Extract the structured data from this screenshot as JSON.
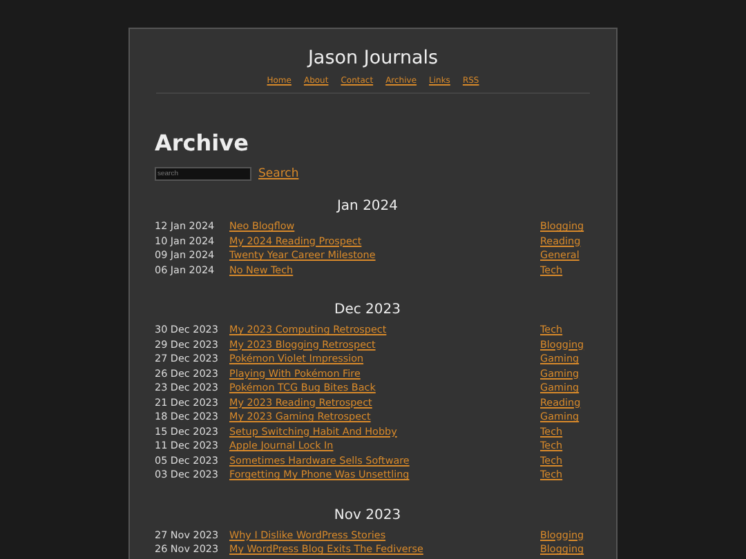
{
  "site_title": "Jason Journals",
  "nav": [
    "Home",
    "About",
    "Contact",
    "Archive",
    "Links",
    "RSS"
  ],
  "heading": "Archive",
  "search": {
    "placeholder": "search",
    "button": "Search"
  },
  "months": [
    {
      "title": "Jan 2024",
      "posts": [
        {
          "date": "12 Jan 2024",
          "title": "Neo Blogflow",
          "category": "Blogging"
        },
        {
          "date": "10 Jan 2024",
          "title": "My 2024 Reading Prospect",
          "category": "Reading"
        },
        {
          "date": "09 Jan 2024",
          "title": "Twenty Year Career Milestone",
          "category": "General"
        },
        {
          "date": "06 Jan 2024",
          "title": "No New Tech",
          "category": "Tech"
        }
      ]
    },
    {
      "title": "Dec 2023",
      "posts": [
        {
          "date": "30 Dec 2023",
          "title": "My 2023 Computing Retrospect",
          "category": "Tech"
        },
        {
          "date": "29 Dec 2023",
          "title": "My 2023 Blogging Retrospect",
          "category": "Blogging"
        },
        {
          "date": "27 Dec 2023",
          "title": "Pokémon Violet Impression",
          "category": "Gaming"
        },
        {
          "date": "26 Dec 2023",
          "title": "Playing With Pokémon Fire",
          "category": "Gaming"
        },
        {
          "date": "23 Dec 2023",
          "title": "Pokémon TCG Bug Bites Back",
          "category": "Gaming"
        },
        {
          "date": "21 Dec 2023",
          "title": "My 2023 Reading Retrospect",
          "category": "Reading"
        },
        {
          "date": "18 Dec 2023",
          "title": "My 2023 Gaming Retrospect",
          "category": "Gaming"
        },
        {
          "date": "15 Dec 2023",
          "title": "Setup Switching Habit And Hobby",
          "category": "Tech"
        },
        {
          "date": "11 Dec 2023",
          "title": "Apple Journal Lock In",
          "category": "Tech"
        },
        {
          "date": "05 Dec 2023",
          "title": "Sometimes Hardware Sells Software",
          "category": "Tech"
        },
        {
          "date": "03 Dec 2023",
          "title": "Forgetting My Phone Was Unsettling",
          "category": "Tech"
        }
      ]
    },
    {
      "title": "Nov 2023",
      "posts": [
        {
          "date": "27 Nov 2023",
          "title": "Why I Dislike WordPress Stories",
          "category": "Blogging"
        },
        {
          "date": "26 Nov 2023",
          "title": "My WordPress Blog Exits The Fediverse",
          "category": "Blogging"
        }
      ]
    }
  ]
}
